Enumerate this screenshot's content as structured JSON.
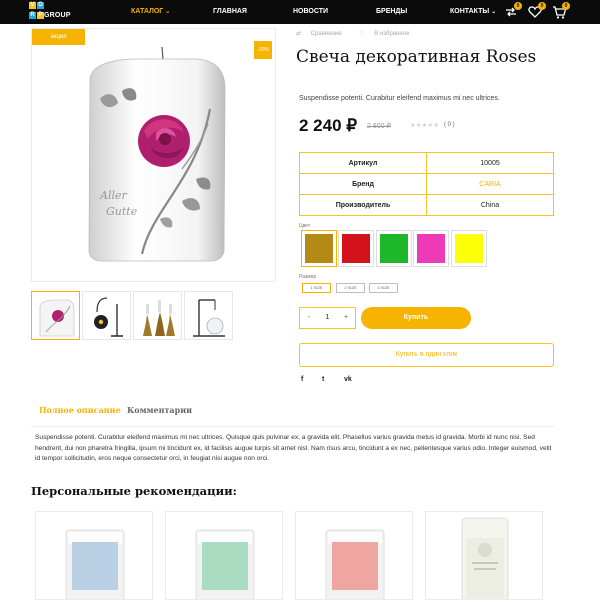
{
  "header": {
    "logo": {
      "tiles": [
        "V",
        "G",
        "R",
        "P"
      ],
      "word": "GROUP"
    },
    "nav": [
      {
        "label": "КАТАЛОГ",
        "active": true,
        "has_dropdown": true
      },
      {
        "label": "ГЛАВНАЯ",
        "active": false,
        "has_dropdown": false
      },
      {
        "label": "НОВОСТИ",
        "active": false,
        "has_dropdown": false
      },
      {
        "label": "БРЕНДЫ",
        "active": false,
        "has_dropdown": false
      },
      {
        "label": "КОНТАКТЫ",
        "active": false,
        "has_dropdown": true
      }
    ],
    "icons": [
      {
        "name": "compare-icon",
        "badge": "0"
      },
      {
        "name": "favorites-icon",
        "badge": "0"
      },
      {
        "name": "cart-icon",
        "badge": "0"
      }
    ]
  },
  "gallery": {
    "sale_tag": "акция",
    "discount_tag": "-20%",
    "thumbnails": [
      "candle-roses",
      "lamp-black",
      "candlesticks-gold",
      "aroma-lamp"
    ],
    "selected_thumbnail": 0
  },
  "product": {
    "compare_label": "Сравнение",
    "favorite_label": "В избранное",
    "title": "Свеча декоративная Roses",
    "short_description": "Suspendisse potenti. Curabitur eleifend maximus mi nec ultrices.",
    "price": "2 240 ₽",
    "old_price": "2 800 ₽",
    "rating_stars": "★★★★★",
    "rating": 0,
    "reviews_count": "( 0 )",
    "specs": [
      {
        "key": "Артикул",
        "value": "10005",
        "link": false
      },
      {
        "key": "Бренд",
        "value": "CARIA",
        "link": true
      },
      {
        "key": "Производитель",
        "value": "China",
        "link": false
      }
    ],
    "color_label": "Цвет",
    "colors": [
      "#b38a16",
      "#d3121b",
      "#1eb72a",
      "#ef3ab8",
      "#fbff08"
    ],
    "selected_color": 0,
    "size_label": "Размер",
    "sizes": [
      "1 SIZE",
      "2 SIZE",
      "3 SIZE"
    ],
    "selected_size": 0,
    "quantity": {
      "minus": "-",
      "value": "1",
      "plus": "+"
    },
    "buy_label": "Купить",
    "one_click_label": "Купить в один клик",
    "social": [
      "f",
      "t",
      "vk"
    ]
  },
  "tabs": [
    {
      "label": "Полное описание",
      "active": true
    },
    {
      "label": "Комментарии",
      "active": false
    }
  ],
  "full_description": "Suspendisse potenti. Curabitur eleifend maximus mi nec ultrices. Quisque quis pulvinar ex, a gravida elit. Phasellus varius gravida metus id gravida. Morbi id nunc nisi. Sed hendrerit, dui non pharetra fringilla, ipsum mi tincidunt ex, id facilisis augue turpis sit amet nisl. Nam risus arcu, tincidunt a ex nec, pellentesque varius odio. Integer euismod, velit id tempor sollicitudin, eros neque consectetur orci, in feugiat nisi augue non orci.",
  "recommendations": {
    "title": "Персональные рекомендации:",
    "items": [
      {
        "label_color": "#b9cfe4"
      },
      {
        "label_color": "#a9dcc0"
      },
      {
        "label_color": "#f0a6a0"
      },
      {
        "label_color": "#ffffff"
      }
    ]
  },
  "colors": {
    "accent": "#f6b400",
    "header_bg": "#0b0b0b"
  }
}
